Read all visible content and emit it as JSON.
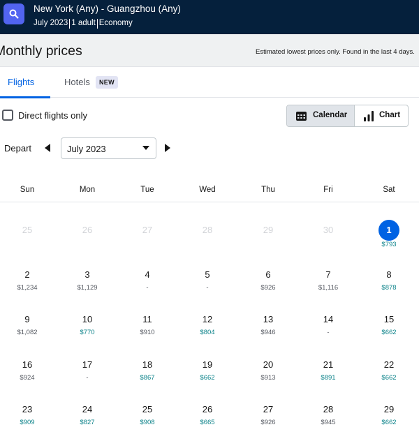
{
  "header": {
    "route": "New York (Any) - Guangzhou (Any)",
    "month": "July 2023",
    "travellers": "1 adult",
    "cabin": "Economy"
  },
  "title_bar": {
    "title": "Monthly prices",
    "notice": "Estimated lowest prices only. Found in the last 4 days."
  },
  "tabs": {
    "flights": "Flights",
    "hotels": "Hotels",
    "hotels_badge": "NEW"
  },
  "filters": {
    "direct_only_label": "Direct flights only",
    "direct_only_checked": false
  },
  "view_toggle": {
    "calendar_label": "Calendar",
    "chart_label": "Chart",
    "active": "calendar"
  },
  "depart": {
    "label": "Depart",
    "selected_month": "July 2023"
  },
  "calendar": {
    "weekdays": [
      "Sun",
      "Mon",
      "Tue",
      "Wed",
      "Thu",
      "Fri",
      "Sat"
    ],
    "weeks": [
      [
        {
          "day": "25",
          "price": "",
          "disabled": true
        },
        {
          "day": "26",
          "price": "",
          "disabled": true
        },
        {
          "day": "27",
          "price": "",
          "disabled": true
        },
        {
          "day": "28",
          "price": "",
          "disabled": true
        },
        {
          "day": "29",
          "price": "",
          "disabled": true
        },
        {
          "day": "30",
          "price": "",
          "disabled": true
        },
        {
          "day": "1",
          "price": "$793",
          "cheap": true,
          "selected": true
        }
      ],
      [
        {
          "day": "2",
          "price": "$1,234"
        },
        {
          "day": "3",
          "price": "$1,129"
        },
        {
          "day": "4",
          "price": "-"
        },
        {
          "day": "5",
          "price": "-"
        },
        {
          "day": "6",
          "price": "$926"
        },
        {
          "day": "7",
          "price": "$1,116"
        },
        {
          "day": "8",
          "price": "$878",
          "cheap": true
        }
      ],
      [
        {
          "day": "9",
          "price": "$1,082"
        },
        {
          "day": "10",
          "price": "$770",
          "cheap": true
        },
        {
          "day": "11",
          "price": "$910"
        },
        {
          "day": "12",
          "price": "$804",
          "cheap": true
        },
        {
          "day": "13",
          "price": "$946"
        },
        {
          "day": "14",
          "price": "-"
        },
        {
          "day": "15",
          "price": "$662",
          "cheap": true
        }
      ],
      [
        {
          "day": "16",
          "price": "$924"
        },
        {
          "day": "17",
          "price": "-"
        },
        {
          "day": "18",
          "price": "$867",
          "cheap": true
        },
        {
          "day": "19",
          "price": "$662",
          "cheap": true
        },
        {
          "day": "20",
          "price": "$913"
        },
        {
          "day": "21",
          "price": "$891",
          "cheap": true
        },
        {
          "day": "22",
          "price": "$662",
          "cheap": true
        }
      ],
      [
        {
          "day": "23",
          "price": "$909",
          "cheap": true
        },
        {
          "day": "24",
          "price": "$827",
          "cheap": true
        },
        {
          "day": "25",
          "price": "$908",
          "cheap": true
        },
        {
          "day": "26",
          "price": "$665",
          "cheap": true
        },
        {
          "day": "27",
          "price": "$926"
        },
        {
          "day": "28",
          "price": "$945"
        },
        {
          "day": "29",
          "price": "$662",
          "cheap": true
        }
      ]
    ]
  },
  "colors": {
    "header_bg": "#05203c",
    "accent": "#0062e3",
    "search_button": "#5264f0",
    "cheap_price": "#0c838a",
    "muted_price": "#545860"
  },
  "icons": {
    "search": "search-icon",
    "calendar": "calendar-icon",
    "chart": "bar-chart-icon",
    "prev": "triangle-left-icon",
    "next": "triangle-right-icon",
    "caret": "caret-down-icon"
  }
}
